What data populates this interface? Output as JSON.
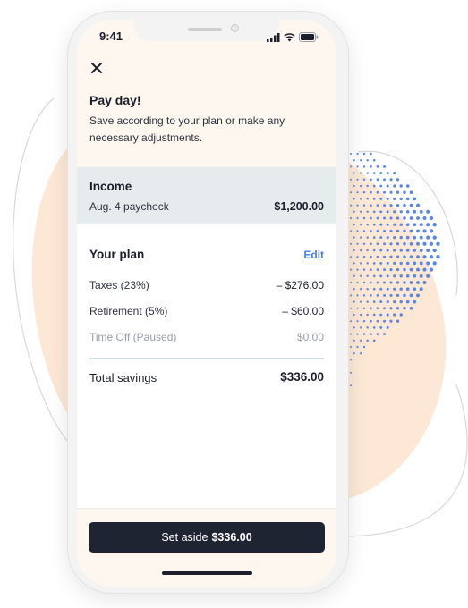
{
  "status_bar": {
    "time": "9:41"
  },
  "header": {
    "title": "Pay day!",
    "subtitle": "Save according to your plan or make any necessary adjustments."
  },
  "income": {
    "title": "Income",
    "source": "Aug. 4 paycheck",
    "amount": "$1,200.00"
  },
  "plan": {
    "title": "Your plan",
    "edit_label": "Edit",
    "rows": [
      {
        "label": "Taxes (23%)",
        "amount": "– $276.00",
        "muted": false
      },
      {
        "label": "Retirement (5%)",
        "amount": "– $60.00",
        "muted": false
      },
      {
        "label": "Time Off (Paused)",
        "amount": "$0.00",
        "muted": true
      }
    ],
    "total_label": "Total savings",
    "total_amount": "$336.00"
  },
  "cta": {
    "prefix": "Set aside",
    "amount": "$336.00"
  },
  "colors": {
    "accent": "#4a7fe0",
    "button": "#1f2433",
    "income_bg": "#e6ecee",
    "screen_bg": "#fdf7f0",
    "blob": "#fce8d5"
  }
}
